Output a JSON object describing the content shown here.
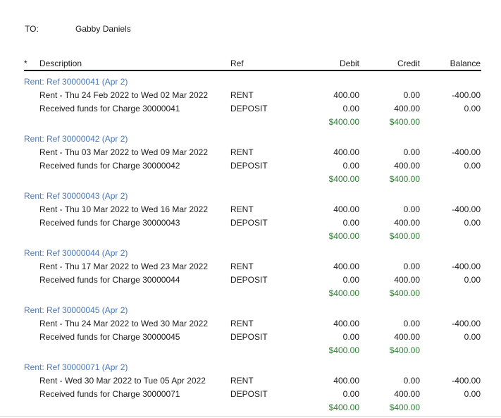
{
  "to": {
    "label": "TO:",
    "name": "Gabby Daniels"
  },
  "columns": {
    "marker": "*",
    "description": "Description",
    "ref": "Ref",
    "debit": "Debit",
    "credit": "Credit",
    "balance": "Balance"
  },
  "groups": [
    {
      "title": "Rent: Ref 30000041 (Apr 2)",
      "rows": [
        {
          "description": "Rent - Thu 24 Feb 2022 to Wed 02 Mar 2022",
          "ref": "RENT",
          "debit": "400.00",
          "credit": "0.00",
          "balance": "-400.00"
        },
        {
          "description": "Received funds for Charge 30000041",
          "ref": "DEPOSIT",
          "debit": "0.00",
          "credit": "400.00",
          "balance": "0.00"
        }
      ],
      "total_debit": "$400.00",
      "total_credit": "$400.00"
    },
    {
      "title": "Rent: Ref 30000042 (Apr 2)",
      "rows": [
        {
          "description": "Rent - Thu 03 Mar 2022 to Wed 09 Mar 2022",
          "ref": "RENT",
          "debit": "400.00",
          "credit": "0.00",
          "balance": "-400.00"
        },
        {
          "description": "Received funds for Charge 30000042",
          "ref": "DEPOSIT",
          "debit": "0.00",
          "credit": "400.00",
          "balance": "0.00"
        }
      ],
      "total_debit": "$400.00",
      "total_credit": "$400.00"
    },
    {
      "title": "Rent: Ref 30000043 (Apr 2)",
      "rows": [
        {
          "description": "Rent - Thu 10 Mar 2022 to Wed 16 Mar 2022",
          "ref": "RENT",
          "debit": "400.00",
          "credit": "0.00",
          "balance": "-400.00"
        },
        {
          "description": "Received funds for Charge 30000043",
          "ref": "DEPOSIT",
          "debit": "0.00",
          "credit": "400.00",
          "balance": "0.00"
        }
      ],
      "total_debit": "$400.00",
      "total_credit": "$400.00"
    },
    {
      "title": "Rent: Ref 30000044 (Apr 2)",
      "rows": [
        {
          "description": "Rent - Thu 17 Mar 2022 to Wed 23 Mar 2022",
          "ref": "RENT",
          "debit": "400.00",
          "credit": "0.00",
          "balance": "-400.00"
        },
        {
          "description": "Received funds for Charge 30000044",
          "ref": "DEPOSIT",
          "debit": "0.00",
          "credit": "400.00",
          "balance": "0.00"
        }
      ],
      "total_debit": "$400.00",
      "total_credit": "$400.00"
    },
    {
      "title": "Rent: Ref 30000045 (Apr 2)",
      "rows": [
        {
          "description": "Rent - Thu 24 Mar 2022 to Wed 30 Mar 2022",
          "ref": "RENT",
          "debit": "400.00",
          "credit": "0.00",
          "balance": "-400.00"
        },
        {
          "description": "Received funds for Charge 30000045",
          "ref": "DEPOSIT",
          "debit": "0.00",
          "credit": "400.00",
          "balance": "0.00"
        }
      ],
      "total_debit": "$400.00",
      "total_credit": "$400.00"
    },
    {
      "title": "Rent: Ref 30000071 (Apr 2)",
      "rows": [
        {
          "description": "Rent - Wed 30 Mar 2022 to Tue 05 Apr 2022",
          "ref": "RENT",
          "debit": "400.00",
          "credit": "0.00",
          "balance": "-400.00"
        },
        {
          "description": "Received funds for Charge 30000071",
          "ref": "DEPOSIT",
          "debit": "0.00",
          "credit": "400.00",
          "balance": "0.00"
        }
      ],
      "total_debit": "$400.00",
      "total_credit": "$400.00"
    }
  ],
  "colors": {
    "group_title": "#4a78b5",
    "total": "#2e7d32",
    "text": "#1c1c1c"
  }
}
